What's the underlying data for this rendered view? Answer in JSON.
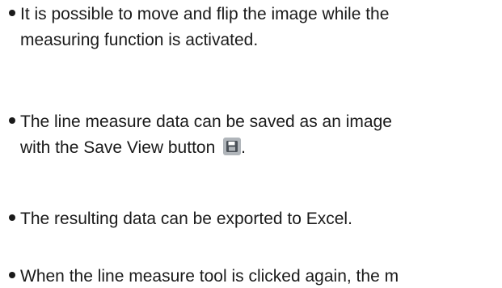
{
  "bullets": [
    {
      "line1": "It is possible to move and flip the image while the",
      "line2": "measuring function is activated."
    },
    {
      "line1": "The line measure data can be saved as an image",
      "line2": "with the Save View button",
      "line2_suffix": "."
    },
    {
      "line1": "The resulting data can be exported to Excel."
    },
    {
      "line1": "When the line measure tool is clicked again, the m"
    }
  ],
  "icons": {
    "save_view": "floppy-disk-icon"
  },
  "colors": {
    "text": "#1a1a1a",
    "icon_bg": "#b0b5ba"
  }
}
